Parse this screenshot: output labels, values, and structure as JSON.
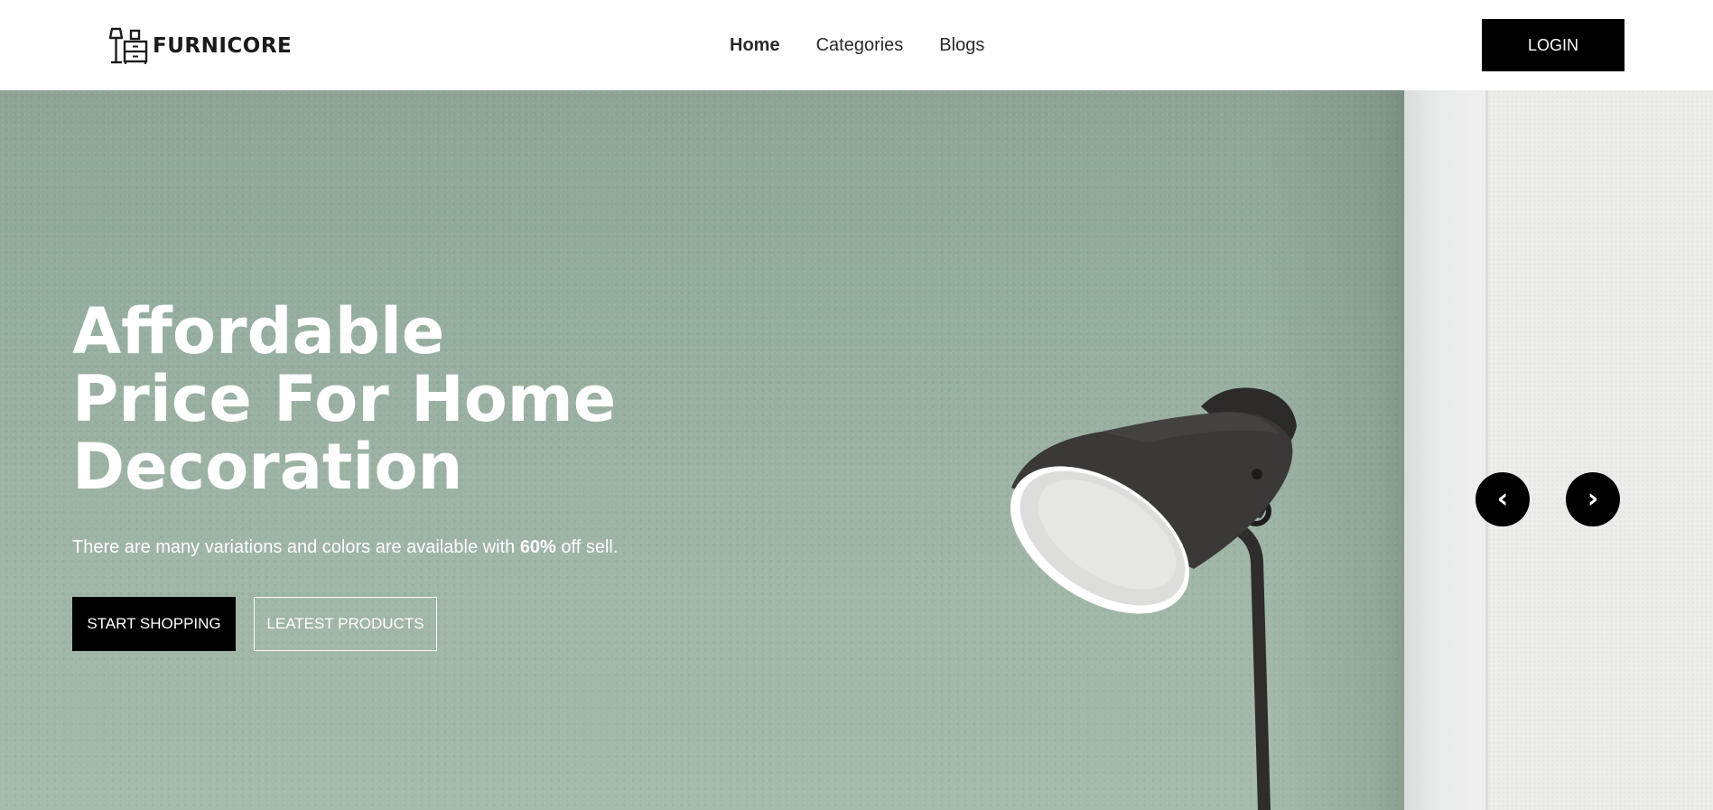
{
  "brand": {
    "name": "FURNICORE",
    "logo_icon": "furniture-lamp-cabinet-icon"
  },
  "nav": {
    "items": [
      {
        "label": "Home",
        "active": true
      },
      {
        "label": "Categories",
        "active": false
      },
      {
        "label": "Blogs",
        "active": false
      }
    ]
  },
  "header": {
    "login_label": "LOGIN"
  },
  "hero": {
    "title_lines": [
      "Affordable",
      "Price For Home",
      "Decoration"
    ],
    "subtitle_before": "There are many variations and colors are available with ",
    "subtitle_highlight": "60%",
    "subtitle_after": " off sell.",
    "primary_button": "START SHOPPING",
    "secondary_button": "LEATEST PRODUCTS",
    "prev_arrow": "‹",
    "next_arrow": "›",
    "background_color": "#95ad9e"
  },
  "colors": {
    "accent": "#000000",
    "text_light": "#ffffff",
    "wall": "#95ad9e"
  }
}
